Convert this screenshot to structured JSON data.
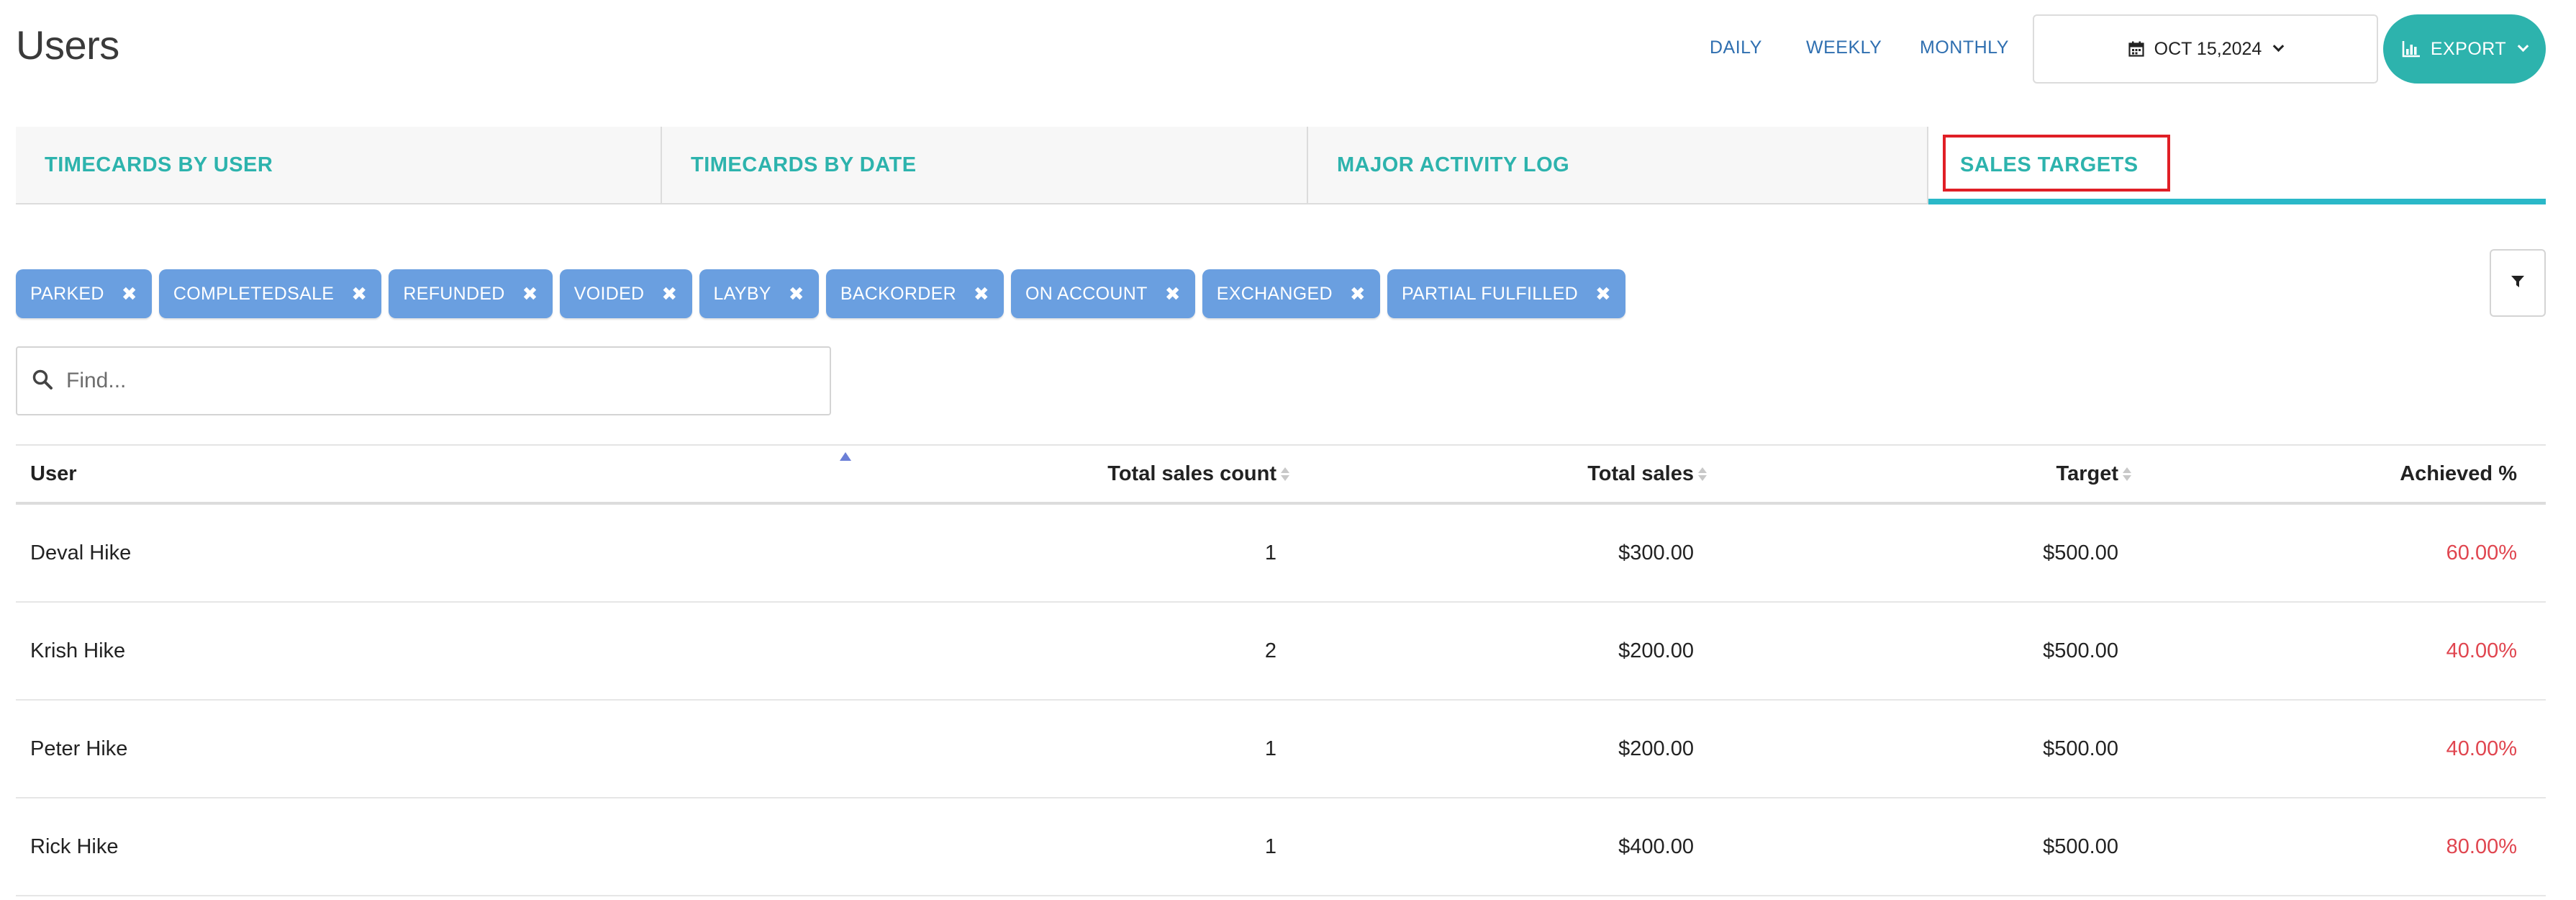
{
  "header": {
    "title": "Users",
    "periods": [
      "DAILY",
      "WEEKLY",
      "MONTHLY"
    ],
    "date_label": "OCT 15,2024",
    "export_label": "EXPORT"
  },
  "tabs": [
    {
      "label": "TIMECARDS BY USER"
    },
    {
      "label": "TIMECARDS BY DATE"
    },
    {
      "label": "MAJOR ACTIVITY LOG"
    },
    {
      "label": "SALES TARGETS",
      "active": true
    }
  ],
  "filters": {
    "chips": [
      "PARKED",
      "COMPLETEDSALE",
      "REFUNDED",
      "VOIDED",
      "LAYBY",
      "BACKORDER",
      "ON ACCOUNT",
      "EXCHANGED",
      "PARTIAL FULFILLED"
    ],
    "remove_glyph": "✖"
  },
  "search": {
    "placeholder": "Find...",
    "value": ""
  },
  "table": {
    "columns": [
      "User",
      "Total sales count",
      "Total sales",
      "Target",
      "Achieved %"
    ],
    "sorted_column": "User",
    "sort_direction": "ascending",
    "rows": [
      {
        "user": "Deval Hike",
        "count": "1",
        "sales": "$300.00",
        "target": "$500.00",
        "achieved": "60.00%"
      },
      {
        "user": "Krish Hike",
        "count": "2",
        "sales": "$200.00",
        "target": "$500.00",
        "achieved": "40.00%"
      },
      {
        "user": "Peter Hike",
        "count": "1",
        "sales": "$200.00",
        "target": "$500.00",
        "achieved": "40.00%"
      },
      {
        "user": "Rick Hike",
        "count": "1",
        "sales": "$400.00",
        "target": "$500.00",
        "achieved": "80.00%"
      }
    ]
  },
  "colors": {
    "accent": "#2db3ad",
    "chip": "#6a9fe0",
    "link": "#2f6fb0",
    "achieved": "#e0454f",
    "highlight": "#e01f26"
  },
  "icons": {
    "date": "calendar-icon",
    "export": "bar-chart-icon",
    "filter": "filter-icon",
    "search": "search-icon"
  }
}
